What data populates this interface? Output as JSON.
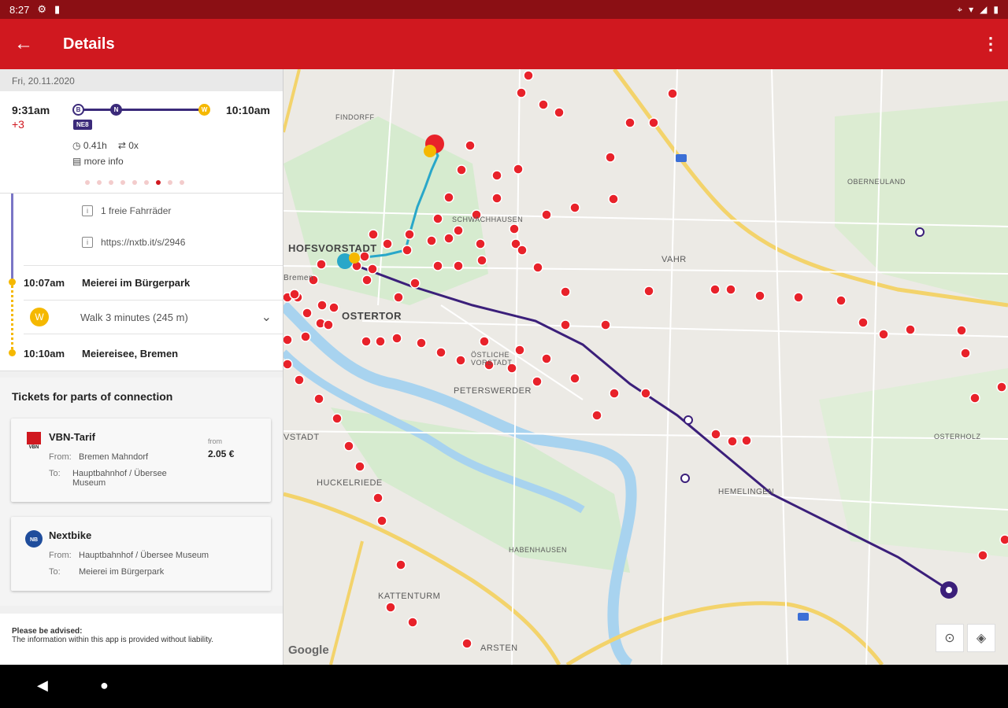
{
  "status": {
    "time": "8:27"
  },
  "appbar": {
    "title": "Details"
  },
  "summary": {
    "date": "Fri, 20.11.2020",
    "departure": "9:31am",
    "delay": "+3",
    "arrival": "10:10am",
    "bus_badge": "NE8",
    "duration": "0.41h",
    "changes": "0x",
    "more_info": "more info",
    "page_count": 9,
    "page_active": 6
  },
  "legs": {
    "info1": "1 freie Fahrräder",
    "info2": "https://nxtb.it/s/2946",
    "stop1_time": "10:07am",
    "stop1_name": "Meierei im Bürgerpark",
    "walk": "Walk 3 minutes (245 m)",
    "stop2_time": "10:10am",
    "stop2_name": "Meiereisee, Bremen"
  },
  "tickets": {
    "heading": "Tickets for parts of connection",
    "cards": [
      {
        "name": "VBN-Tarif",
        "from_label": "From:",
        "from": "Bremen Mahndorf",
        "to_label": "To:",
        "to": "Hauptbahnhof / Übersee Museum",
        "price_label": "from",
        "price": "2.05 €",
        "logo": "vbn-logo"
      },
      {
        "name": "Nextbike",
        "from_label": "From:",
        "from": "Hauptbahnhof / Übersee Museum",
        "to_label": "To:",
        "to": "Meierei im Bürgerpark",
        "logo": "nextbike-logo"
      }
    ]
  },
  "advise": {
    "title": "Please be advised:",
    "text": "The information within this app is provided without liability."
  },
  "map": {
    "labels": {
      "findorff": "FINDORFF",
      "schwachhausen": "SCHWACHHAUSEN",
      "vorstadt": "HOFSVORSTADT",
      "vahr": "VAHR",
      "ostertor": "OSTERTOR",
      "bremen": "Bremen",
      "oestliche": "ÖSTLICHE VORSTADT",
      "peterswerder": "PETERSWERDER",
      "neustadt": "VSTADT",
      "huckelriede": "HUCKELRIEDE",
      "hemelingen": "HEMELINGEN",
      "habenhausen": "HABENHAUSEN",
      "kattenturm": "KATTENTURM",
      "arsten": "ARSTEN",
      "oberneuland": "OBERNEULAND",
      "osterholz": "OSTERHOLZ",
      "google": "Google"
    },
    "colors": {
      "route": "#3b1f7a",
      "bike": "#29a7c9",
      "stop": "#e8222a"
    }
  },
  "icons": {
    "back": "arrow-left-icon",
    "overflow": "more-vert-icon",
    "locate": "my-location-icon",
    "layers": "layers-icon",
    "nav_back": "nav-back-icon",
    "nav_home": "nav-home-icon"
  }
}
